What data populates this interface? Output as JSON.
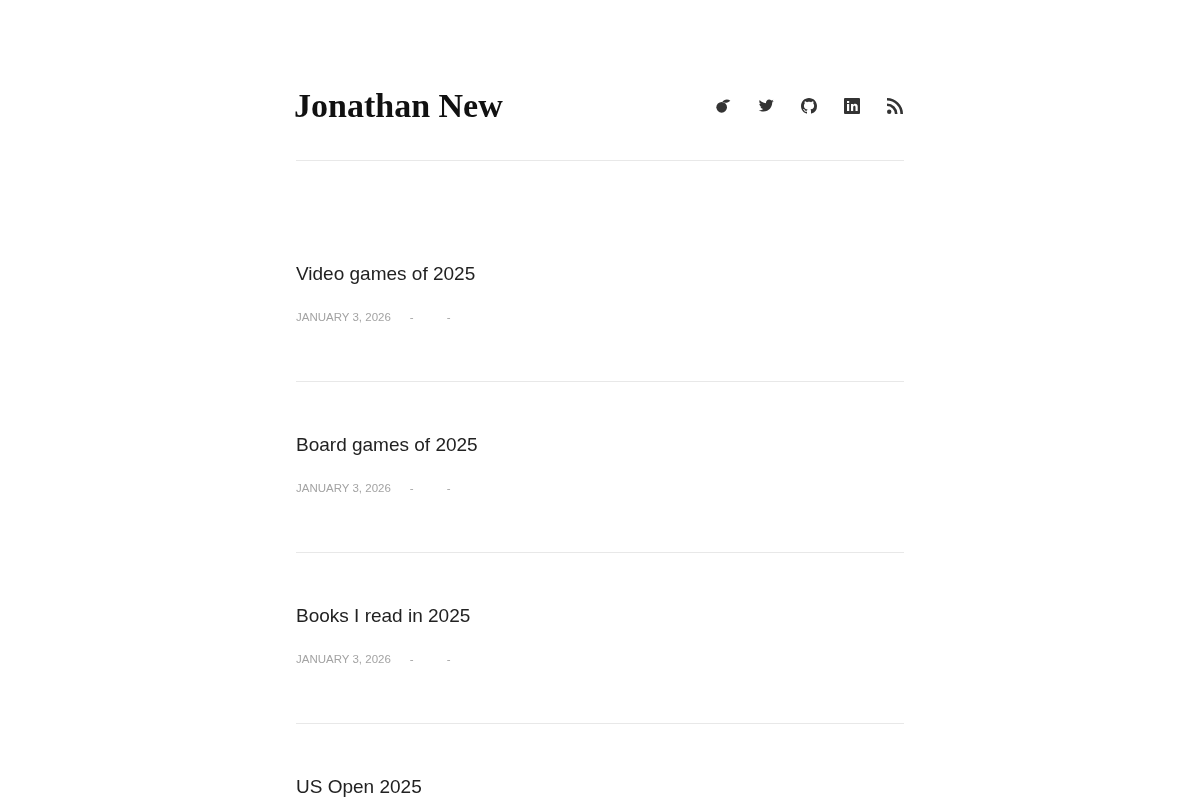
{
  "site_title": "Jonathan New",
  "posts": [
    {
      "title": "Video games of 2025",
      "date": "JANUARY 3, 2026",
      "separators": [
        "-",
        "-"
      ]
    },
    {
      "title": "Board games of 2025",
      "date": "JANUARY 3, 2026",
      "separators": [
        "-",
        "-"
      ]
    },
    {
      "title": "Books I read in 2025",
      "date": "JANUARY 3, 2026",
      "separators": [
        "-",
        "-"
      ]
    },
    {
      "title": "US Open 2025"
    }
  ]
}
